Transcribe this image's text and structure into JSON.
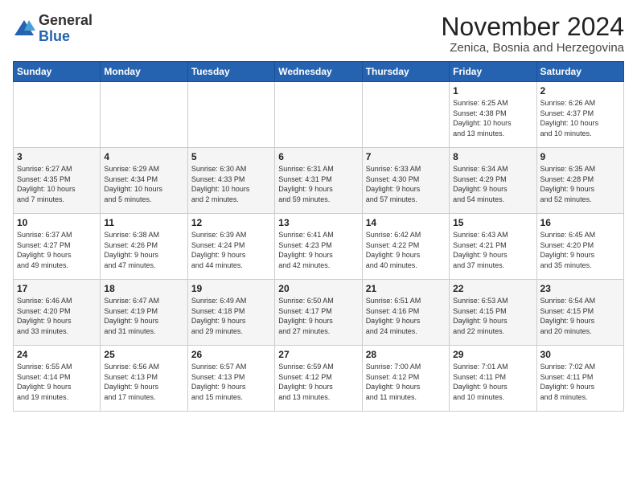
{
  "logo": {
    "general": "General",
    "blue": "Blue"
  },
  "header": {
    "month": "November 2024",
    "location": "Zenica, Bosnia and Herzegovina"
  },
  "weekdays": [
    "Sunday",
    "Monday",
    "Tuesday",
    "Wednesday",
    "Thursday",
    "Friday",
    "Saturday"
  ],
  "weeks": [
    [
      {
        "day": "",
        "info": ""
      },
      {
        "day": "",
        "info": ""
      },
      {
        "day": "",
        "info": ""
      },
      {
        "day": "",
        "info": ""
      },
      {
        "day": "",
        "info": ""
      },
      {
        "day": "1",
        "info": "Sunrise: 6:25 AM\nSunset: 4:38 PM\nDaylight: 10 hours\nand 13 minutes."
      },
      {
        "day": "2",
        "info": "Sunrise: 6:26 AM\nSunset: 4:37 PM\nDaylight: 10 hours\nand 10 minutes."
      }
    ],
    [
      {
        "day": "3",
        "info": "Sunrise: 6:27 AM\nSunset: 4:35 PM\nDaylight: 10 hours\nand 7 minutes."
      },
      {
        "day": "4",
        "info": "Sunrise: 6:29 AM\nSunset: 4:34 PM\nDaylight: 10 hours\nand 5 minutes."
      },
      {
        "day": "5",
        "info": "Sunrise: 6:30 AM\nSunset: 4:33 PM\nDaylight: 10 hours\nand 2 minutes."
      },
      {
        "day": "6",
        "info": "Sunrise: 6:31 AM\nSunset: 4:31 PM\nDaylight: 9 hours\nand 59 minutes."
      },
      {
        "day": "7",
        "info": "Sunrise: 6:33 AM\nSunset: 4:30 PM\nDaylight: 9 hours\nand 57 minutes."
      },
      {
        "day": "8",
        "info": "Sunrise: 6:34 AM\nSunset: 4:29 PM\nDaylight: 9 hours\nand 54 minutes."
      },
      {
        "day": "9",
        "info": "Sunrise: 6:35 AM\nSunset: 4:28 PM\nDaylight: 9 hours\nand 52 minutes."
      }
    ],
    [
      {
        "day": "10",
        "info": "Sunrise: 6:37 AM\nSunset: 4:27 PM\nDaylight: 9 hours\nand 49 minutes."
      },
      {
        "day": "11",
        "info": "Sunrise: 6:38 AM\nSunset: 4:26 PM\nDaylight: 9 hours\nand 47 minutes."
      },
      {
        "day": "12",
        "info": "Sunrise: 6:39 AM\nSunset: 4:24 PM\nDaylight: 9 hours\nand 44 minutes."
      },
      {
        "day": "13",
        "info": "Sunrise: 6:41 AM\nSunset: 4:23 PM\nDaylight: 9 hours\nand 42 minutes."
      },
      {
        "day": "14",
        "info": "Sunrise: 6:42 AM\nSunset: 4:22 PM\nDaylight: 9 hours\nand 40 minutes."
      },
      {
        "day": "15",
        "info": "Sunrise: 6:43 AM\nSunset: 4:21 PM\nDaylight: 9 hours\nand 37 minutes."
      },
      {
        "day": "16",
        "info": "Sunrise: 6:45 AM\nSunset: 4:20 PM\nDaylight: 9 hours\nand 35 minutes."
      }
    ],
    [
      {
        "day": "17",
        "info": "Sunrise: 6:46 AM\nSunset: 4:20 PM\nDaylight: 9 hours\nand 33 minutes."
      },
      {
        "day": "18",
        "info": "Sunrise: 6:47 AM\nSunset: 4:19 PM\nDaylight: 9 hours\nand 31 minutes."
      },
      {
        "day": "19",
        "info": "Sunrise: 6:49 AM\nSunset: 4:18 PM\nDaylight: 9 hours\nand 29 minutes."
      },
      {
        "day": "20",
        "info": "Sunrise: 6:50 AM\nSunset: 4:17 PM\nDaylight: 9 hours\nand 27 minutes."
      },
      {
        "day": "21",
        "info": "Sunrise: 6:51 AM\nSunset: 4:16 PM\nDaylight: 9 hours\nand 24 minutes."
      },
      {
        "day": "22",
        "info": "Sunrise: 6:53 AM\nSunset: 4:15 PM\nDaylight: 9 hours\nand 22 minutes."
      },
      {
        "day": "23",
        "info": "Sunrise: 6:54 AM\nSunset: 4:15 PM\nDaylight: 9 hours\nand 20 minutes."
      }
    ],
    [
      {
        "day": "24",
        "info": "Sunrise: 6:55 AM\nSunset: 4:14 PM\nDaylight: 9 hours\nand 19 minutes."
      },
      {
        "day": "25",
        "info": "Sunrise: 6:56 AM\nSunset: 4:13 PM\nDaylight: 9 hours\nand 17 minutes."
      },
      {
        "day": "26",
        "info": "Sunrise: 6:57 AM\nSunset: 4:13 PM\nDaylight: 9 hours\nand 15 minutes."
      },
      {
        "day": "27",
        "info": "Sunrise: 6:59 AM\nSunset: 4:12 PM\nDaylight: 9 hours\nand 13 minutes."
      },
      {
        "day": "28",
        "info": "Sunrise: 7:00 AM\nSunset: 4:12 PM\nDaylight: 9 hours\nand 11 minutes."
      },
      {
        "day": "29",
        "info": "Sunrise: 7:01 AM\nSunset: 4:11 PM\nDaylight: 9 hours\nand 10 minutes."
      },
      {
        "day": "30",
        "info": "Sunrise: 7:02 AM\nSunset: 4:11 PM\nDaylight: 9 hours\nand 8 minutes."
      }
    ]
  ]
}
